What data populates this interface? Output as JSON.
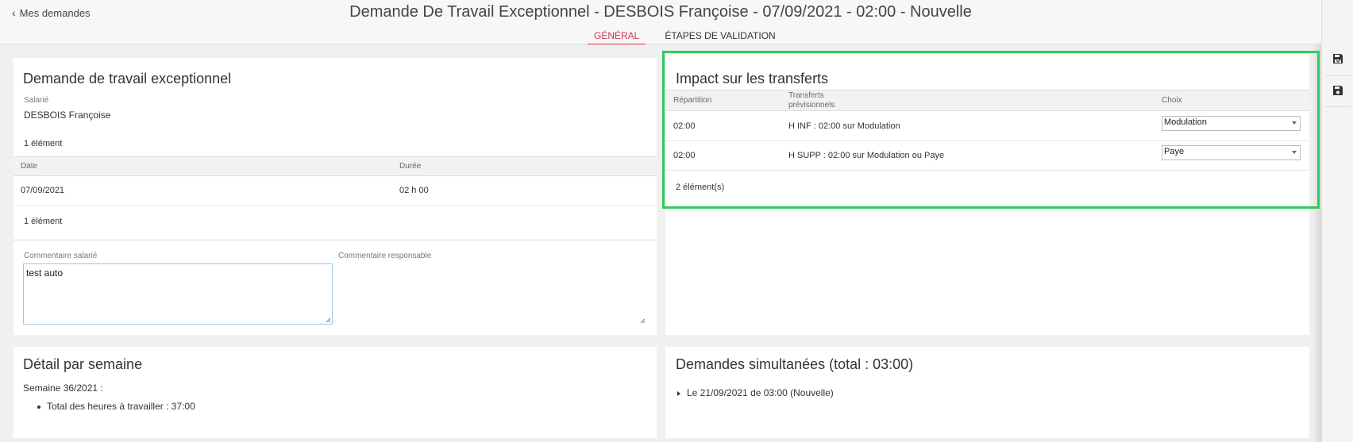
{
  "header": {
    "back_label": "Mes demandes",
    "title": "Demande De Travail Exceptionnel - DESBOIS Françoise - 07/09/2021 - 02:00 - Nouvelle",
    "tabs": [
      {
        "label": "GÉNÉRAL",
        "active": true
      },
      {
        "label": "ÉTAPES DE VALIDATION",
        "active": false
      }
    ]
  },
  "rail": {
    "buttons": [
      {
        "icon": "save-and-close-icon"
      },
      {
        "icon": "save-icon"
      }
    ]
  },
  "demande": {
    "title": "Demande de travail exceptionnel",
    "salarie_label": "Salarié",
    "salarie_value": "DESBOIS Françoise",
    "count_top": "1 élément",
    "columns": [
      "Date",
      "Durée"
    ],
    "rows": [
      {
        "date": "07/09/2021",
        "duree": "02 h 00"
      }
    ],
    "count_bottom": "1 élément"
  },
  "comments": {
    "salarie_label": "Commentaire salarié",
    "salarie_value": "test auto",
    "responsable_label": "Commentaire responsable",
    "responsable_value": ""
  },
  "impact": {
    "title": "Impact sur les transferts",
    "columns": [
      "Répartition",
      "Transferts",
      "prévisionnels",
      "Choix"
    ],
    "rows": [
      {
        "repartition": "02:00",
        "transfert": "H INF : 02:00 sur Modulation",
        "choix": "Modulation"
      },
      {
        "repartition": "02:00",
        "transfert": "H SUPP : 02:00 sur Modulation ou Paye",
        "choix": "Paye"
      }
    ],
    "count": "2 élément(s)"
  },
  "detail": {
    "title": "Détail par semaine",
    "week": "Semaine 36/2021 :",
    "items": [
      "Total des heures à travailler : 37:00"
    ]
  },
  "simultanees": {
    "title": "Demandes simultanées (total : 03:00)",
    "items": [
      "Le 21/09/2021 de 03:00 (Nouvelle)"
    ]
  },
  "colors": {
    "accent": "#d6354a",
    "highlight": "#2ecc5a",
    "input_border": "#9cc7e4"
  }
}
